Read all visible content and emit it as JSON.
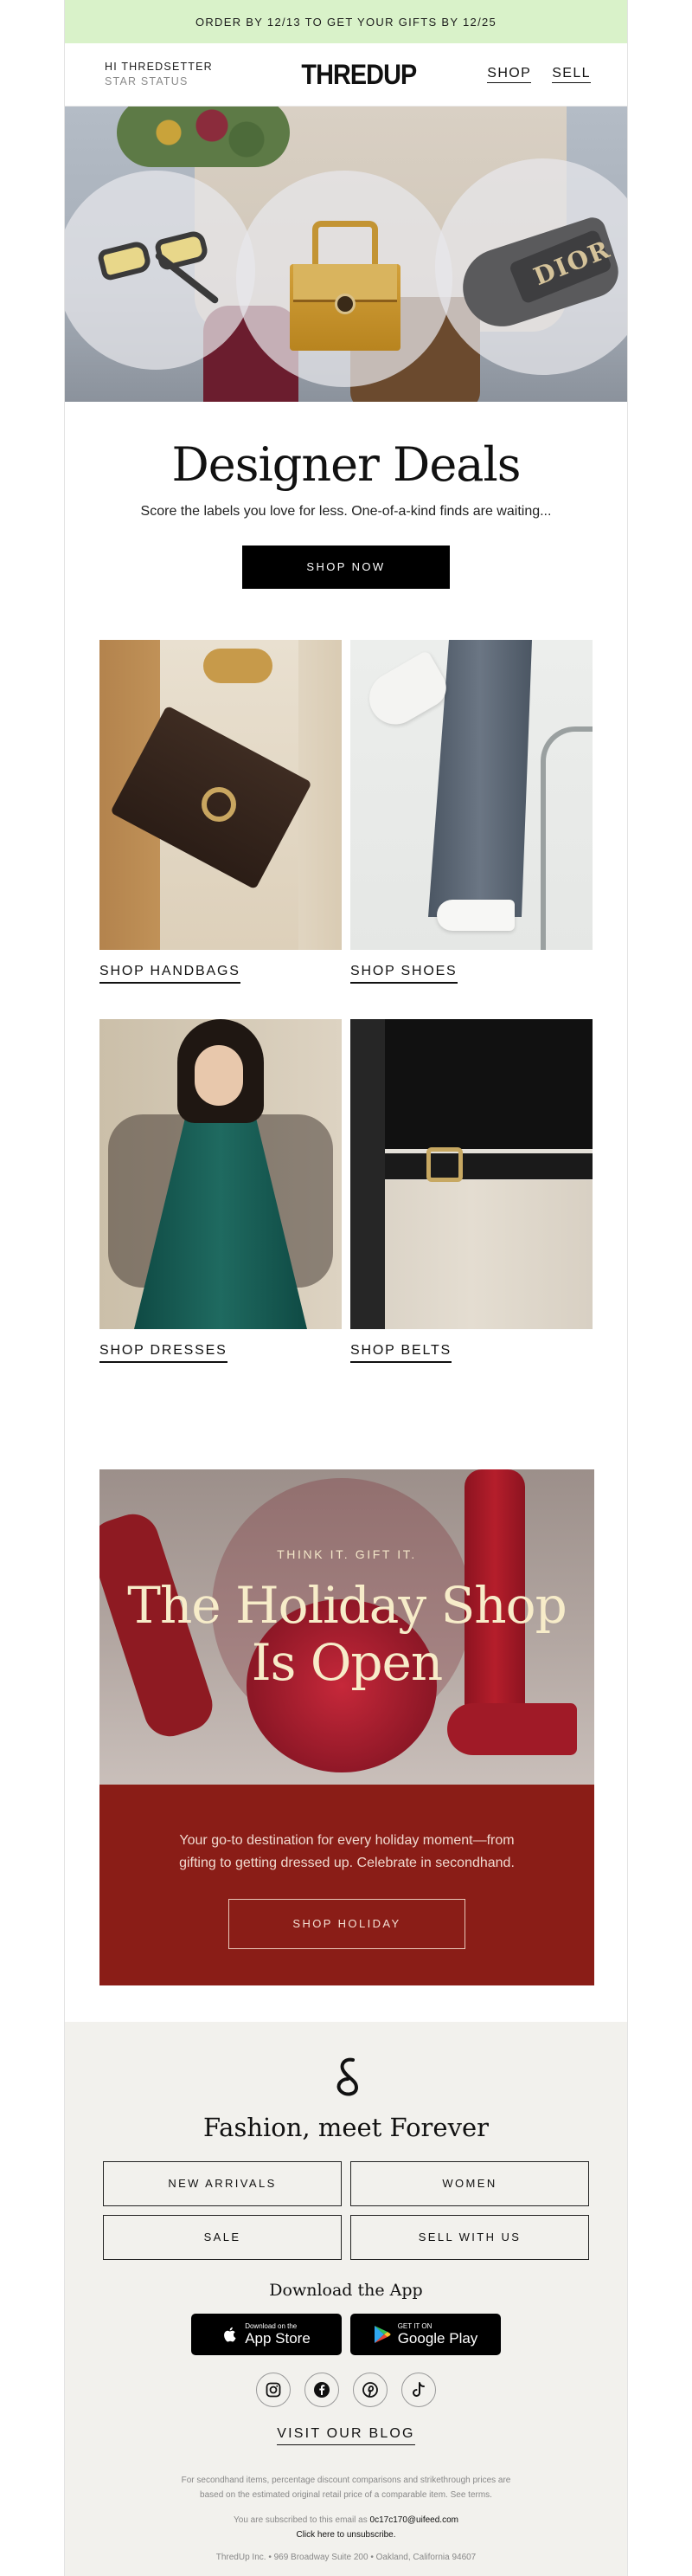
{
  "banner": {
    "text": "ORDER BY 12/13 TO GET YOUR GIFTS BY 12/25"
  },
  "header": {
    "greeting": "HI THREDSETTER",
    "status": "STAR STATUS",
    "logo": "THREDUP",
    "nav": {
      "shop": "SHOP",
      "sell": "SELL"
    }
  },
  "hero": {
    "slide_brand": "DIOR"
  },
  "deals": {
    "title": "Designer Deals",
    "subtitle": "Score the labels you love for less. One-of-a-kind finds are waiting...",
    "cta": "SHOP NOW"
  },
  "tiles": [
    {
      "label": "SHOP HANDBAGS"
    },
    {
      "label": "SHOP SHOES"
    },
    {
      "label": "SHOP DRESSES"
    },
    {
      "label": "SHOP BELTS"
    }
  ],
  "holiday": {
    "kicker": "THINK IT. GIFT IT.",
    "title_line1": "The Holiday Shop",
    "title_line2": "Is Open",
    "body": "Your go-to destination for every holiday moment—from gifting to getting dressed up. Celebrate in secondhand.",
    "cta": "SHOP HOLIDAY",
    "bg_color": "#8a1d17"
  },
  "footer": {
    "tagline": "Fashion, meet Forever",
    "categories": [
      "NEW ARRIVALS",
      "WOMEN",
      "SALE",
      "SELL WITH US"
    ],
    "download_title": "Download the App",
    "app_store": {
      "small": "Download on the",
      "big": "App Store"
    },
    "google_play": {
      "small": "GET IT ON",
      "big": "Google Play"
    },
    "socials": [
      "instagram-icon",
      "facebook-icon",
      "pinterest-icon",
      "tiktok-icon"
    ],
    "blog": "VISIT OUR BLOG",
    "legal_line1": "For secondhand items, percentage discount comparisons and strikethrough prices are",
    "legal_line2": "based on the estimated original retail price of a comparable item. See terms.",
    "subscribed_prefix": "You are subscribed to this email as",
    "email": "0c17c170@uifeed.com",
    "unsubscribe": "Click here to unsubscribe.",
    "address": "ThredUp Inc. • 969 Broadway Suite 200 • Oakland, California 94607"
  },
  "colors": {
    "banner_bg": "#d9f2c9",
    "footer_bg": "#f2f1ed",
    "holiday_red": "#8a1d17"
  }
}
